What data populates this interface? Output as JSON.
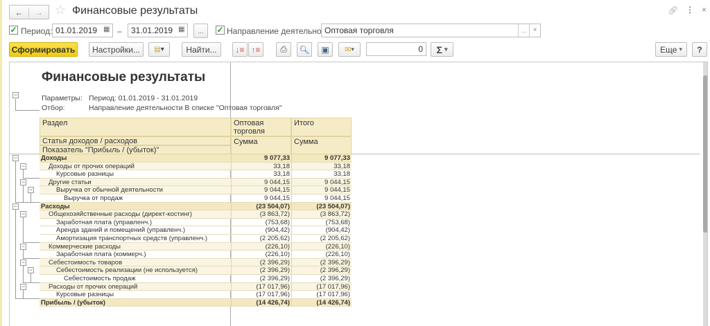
{
  "window": {
    "title": "Финансовые результаты",
    "back_icon": "arrow-left-icon",
    "forward_icon": "arrow-right-icon",
    "favorite_icon": "star-icon"
  },
  "filters": {
    "period_label": "Период:",
    "period_checked": true,
    "date_from": "01.01.2019",
    "date_to": "31.01.2019",
    "dash": "–",
    "more_btn": "...",
    "direction_label": "Направление деятельности:",
    "direction_checked": true,
    "direction_value": "Оптовая торговля",
    "dots": "...",
    "clear": "×"
  },
  "toolbar": {
    "generate": "Сформировать",
    "settings": "Настройки...",
    "find": "Найти...",
    "sum_value": "0",
    "sigma": "Σ",
    "more": "Еще",
    "help": "?"
  },
  "report": {
    "title": "Финансовые результаты",
    "params_label": "Параметры:",
    "params_value": "Период: 01.01.2019 - 31.01.2019",
    "filter_label": "Отбор:",
    "filter_value": "Направление деятельности В списке \"Оптовая торговля\"",
    "headers": {
      "section": "Раздел",
      "article": "Статья доходов / расходов",
      "indicator": "Показатель \"Прибыль / (убыток)\"",
      "col1": "Оптовая торговля",
      "col2": "Итого",
      "sum1": "Сумма",
      "sum2": "Сумма"
    },
    "rows": [
      {
        "name": "Доходы",
        "level": 0,
        "group": true,
        "v1": "9 077,33",
        "v2": "9 077,33"
      },
      {
        "name": "Доходы от прочих операций",
        "level": 1,
        "group": true,
        "v1": "33,18",
        "v2": "33,18"
      },
      {
        "name": "Курсовые разницы",
        "level": 2,
        "group": false,
        "v1": "33,18",
        "v2": "33,18"
      },
      {
        "name": "Другие статьи",
        "level": 1,
        "group": true,
        "v1": "9 044,15",
        "v2": "9 044,15"
      },
      {
        "name": "Выручка от обычной деятельности",
        "level": 2,
        "group": true,
        "v1": "9 044,15",
        "v2": "9 044,15"
      },
      {
        "name": "Выручка от продаж",
        "level": 3,
        "group": false,
        "v1": "9 044,15",
        "v2": "9 044,15"
      },
      {
        "name": "Расходы",
        "level": 0,
        "group": true,
        "v1": "(23 504,07)",
        "v2": "(23 504,07)"
      },
      {
        "name": "Общехозяйственные расходы (директ-костинг)",
        "level": 1,
        "group": true,
        "v1": "(3 863,72)",
        "v2": "(3 863,72)"
      },
      {
        "name": "Заработная плата (управленч.)",
        "level": 2,
        "group": false,
        "v1": "(753,68)",
        "v2": "(753,68)"
      },
      {
        "name": "Аренда зданий и помещений (управленч.)",
        "level": 2,
        "group": false,
        "v1": "(904,42)",
        "v2": "(904,42)"
      },
      {
        "name": "Амортизация транспортных средств (управленч.)",
        "level": 2,
        "group": false,
        "v1": "(2 205,62)",
        "v2": "(2 205,62)"
      },
      {
        "name": "Коммерческие расходы",
        "level": 1,
        "group": true,
        "v1": "(226,10)",
        "v2": "(226,10)"
      },
      {
        "name": "Заработная плата (коммерч.)",
        "level": 2,
        "group": false,
        "v1": "(226,10)",
        "v2": "(226,10)"
      },
      {
        "name": "Себестоимость товаров",
        "level": 1,
        "group": true,
        "v1": "(2 396,29)",
        "v2": "(2 396,29)"
      },
      {
        "name": "Себестоимость реализации (не используется)",
        "level": 2,
        "group": true,
        "v1": "(2 396,29)",
        "v2": "(2 396,29)"
      },
      {
        "name": "Себестоимость продаж",
        "level": 3,
        "group": false,
        "v1": "(2 396,29)",
        "v2": "(2 396,29)"
      },
      {
        "name": "Расходы от прочих операций",
        "level": 1,
        "group": true,
        "v1": "(17 017,96)",
        "v2": "(17 017,96)"
      },
      {
        "name": "Курсовые разницы",
        "level": 2,
        "group": false,
        "v1": "(17 017,96)",
        "v2": "(17 017,96)"
      },
      {
        "name": "Прибыль / (убыток)",
        "level": 0,
        "group": false,
        "v1": "(14 426,74)",
        "v2": "(14 426,74)"
      }
    ]
  }
}
